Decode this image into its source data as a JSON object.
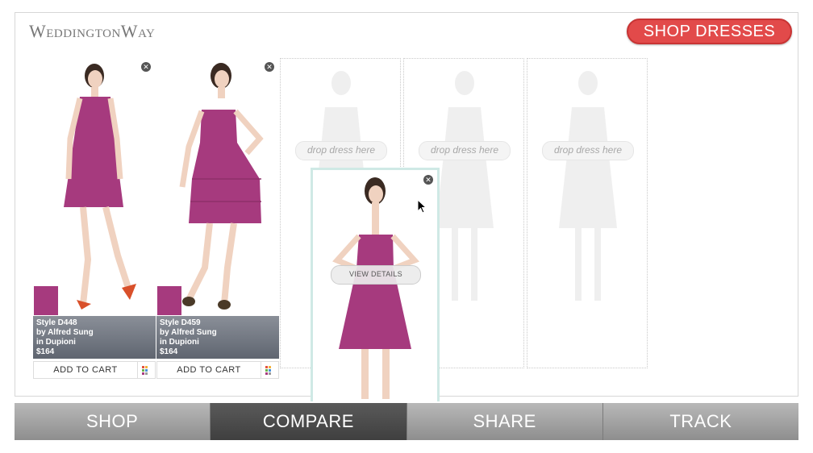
{
  "header": {
    "logo_text": "WeddingtonWay",
    "shop_button": "SHOP DRESSES"
  },
  "colors": {
    "dress": "#a63a7e",
    "accent": "#e24a4a"
  },
  "cards": [
    {
      "style": "Style D448",
      "designer": "by Alfred Sung",
      "fabric": "in Dupioni",
      "price": "$164",
      "cart_label": "ADD TO CART"
    },
    {
      "style": "Style D459",
      "designer": "by Alfred Sung",
      "fabric": "in Dupioni",
      "price": "$164",
      "cart_label": "ADD TO CART"
    }
  ],
  "slots": [
    {
      "label": "drop dress here"
    },
    {
      "label": "drop dress here"
    },
    {
      "label": "drop dress here"
    }
  ],
  "dragged": {
    "view_label": "VIEW DETAILS"
  },
  "nav": {
    "tabs": [
      "SHOP",
      "COMPARE",
      "SHARE",
      "TRACK"
    ],
    "active": "COMPARE"
  }
}
